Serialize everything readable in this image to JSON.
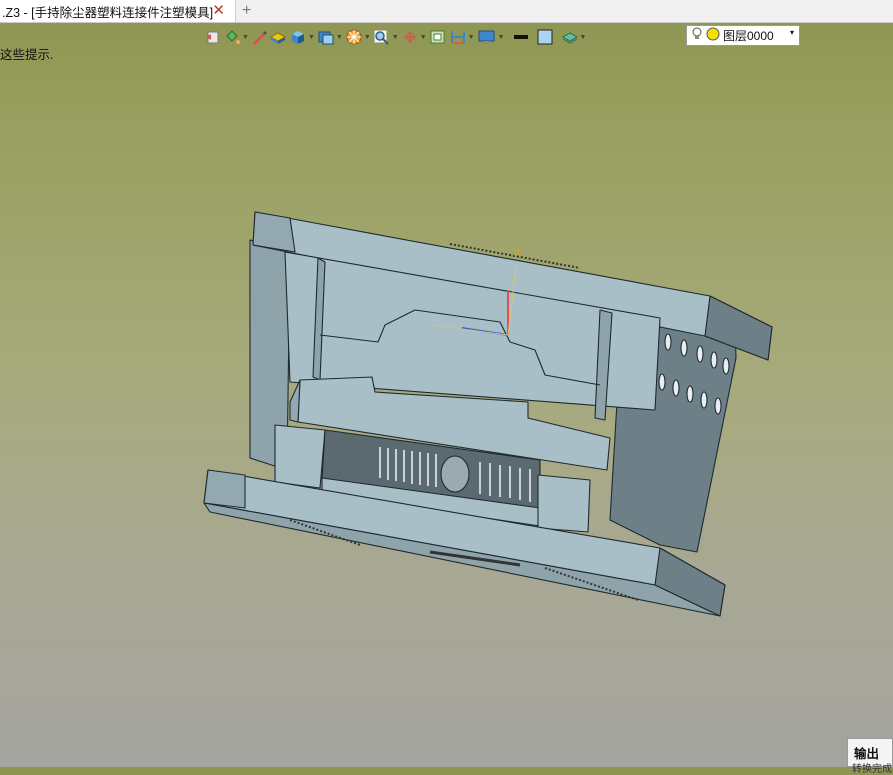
{
  "tab": {
    "title": ".Z3 - [手持除尘器塑料连接件注塑模具]",
    "close": "✕",
    "add": "+"
  },
  "hint": "这些提示.",
  "toolbar": {
    "icons": [
      "undo-icon",
      "paint-bucket-icon",
      "pen-icon",
      "face-color-icon",
      "solid-icon",
      "view-cube-icon",
      "section-icon",
      "zoom-icon",
      "axis-icon",
      "frame-icon",
      "measure-icon",
      "display-icon",
      "line-weight-icon",
      "color-swatch-icon",
      "layer-stack-icon"
    ],
    "accent": "#3f86c8"
  },
  "layer": {
    "name": "图层0000",
    "arrow": "▾"
  },
  "output": {
    "label": "输出",
    "sub": "转换完成"
  },
  "model": {
    "name": "injection-mold-assembly",
    "fill": "#a9bfc8",
    "edge": "#1e2a30",
    "dark": "#6d7f87"
  }
}
